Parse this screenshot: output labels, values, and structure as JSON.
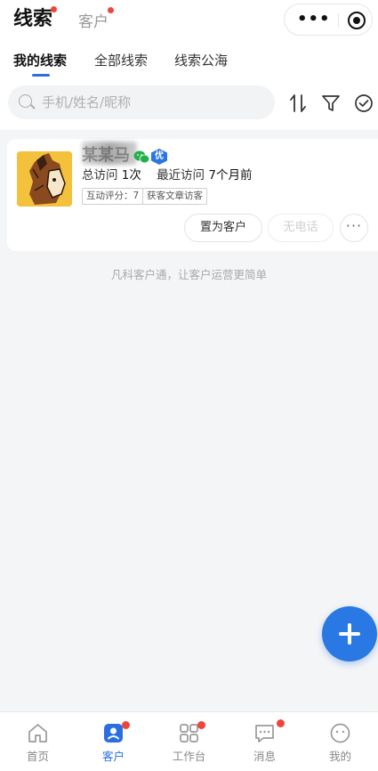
{
  "header": {
    "tab_leads": "线索",
    "tab_customers": "客户"
  },
  "subtabs": {
    "mine": "我的线索",
    "all": "全部线索",
    "pool": "线索公海"
  },
  "search": {
    "placeholder": "手机/姓名/昵称"
  },
  "card": {
    "name": "某某马",
    "vip_badge": "优",
    "total_visits_label": "总访问",
    "total_visits_value": "1次",
    "last_visit_label": "最近访问",
    "last_visit_value": "7个月前",
    "tag_score": "互动评分：7",
    "tag_source": "获客文章访客",
    "btn_set_customer": "置为客户",
    "btn_no_phone": "无电话",
    "btn_more": "···"
  },
  "footer_tip": "凡科客户通，让客户运营更简单",
  "tabbar": {
    "home": "首页",
    "customers": "客户",
    "workbench": "工作台",
    "messages": "消息",
    "mine": "我的"
  },
  "colors": {
    "accent": "#2a6fe0",
    "badge_red": "#f0453a",
    "wechat_green": "#23b04b"
  },
  "icons": [
    "search-icon",
    "sort-icon",
    "filter-icon",
    "check-circle-icon",
    "wechat-icon",
    "plus-icon",
    "home-icon",
    "customer-icon",
    "workbench-icon",
    "message-icon",
    "profile-icon"
  ]
}
